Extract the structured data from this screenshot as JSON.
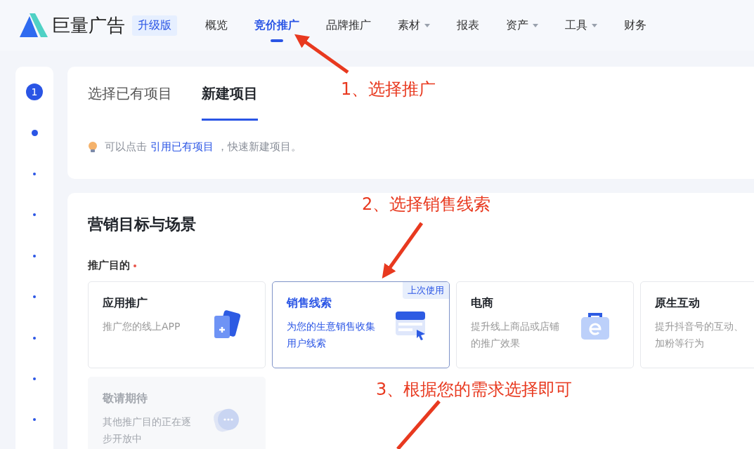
{
  "header": {
    "logo": "巨量广告",
    "edition_badge": "升级版",
    "nav": [
      {
        "label": "概览",
        "selected": false,
        "dropdown": false
      },
      {
        "label": "竞价推广",
        "selected": true,
        "dropdown": false
      },
      {
        "label": "品牌推广",
        "selected": false,
        "dropdown": false
      },
      {
        "label": "素材",
        "selected": false,
        "dropdown": true
      },
      {
        "label": "报表",
        "selected": false,
        "dropdown": false
      },
      {
        "label": "资产",
        "selected": false,
        "dropdown": true
      },
      {
        "label": "工具",
        "selected": false,
        "dropdown": true
      },
      {
        "label": "财务",
        "selected": false,
        "dropdown": false
      }
    ]
  },
  "steps": [
    {
      "kind": "number",
      "label": "1"
    },
    {
      "kind": "large-dot"
    },
    {
      "kind": "dot"
    },
    {
      "kind": "dot"
    },
    {
      "kind": "dot"
    },
    {
      "kind": "dot"
    },
    {
      "kind": "dot"
    },
    {
      "kind": "dot"
    },
    {
      "kind": "dot"
    }
  ],
  "project_panel": {
    "tabs": [
      {
        "label": "选择已有项目",
        "selected": false
      },
      {
        "label": "新建项目",
        "selected": true
      }
    ],
    "hint": {
      "prefix": "可以点击 ",
      "link": "引用已有项目",
      "suffix": " ，快速新建项目。"
    }
  },
  "goal_panel": {
    "title": "营销目标与场景",
    "field_label": "推广目的",
    "required": true,
    "options": [
      {
        "kind": "app",
        "title": "应用推广",
        "description": "推广您的线上APP",
        "selected": false,
        "disabled": false
      },
      {
        "kind": "leads",
        "title": "销售线索",
        "description": "为您的生意销售收集用户线索",
        "selected": true,
        "disabled": false,
        "badge": "上次使用"
      },
      {
        "kind": "ecommerce",
        "title": "电商",
        "description": "提升线上商品或店铺的推广效果",
        "selected": false,
        "disabled": false
      },
      {
        "kind": "interaction",
        "title": "原生互动",
        "description": "提升抖音号的互动、加粉等行为",
        "selected": false,
        "disabled": false
      },
      {
        "kind": "coming-soon",
        "title": "敬请期待",
        "description": "其他推广目的正在逐步开放中",
        "selected": false,
        "disabled": true
      }
    ]
  },
  "annotations": [
    {
      "text": "1、选择推广"
    },
    {
      "text": "2、选择销售线索"
    },
    {
      "text": "3、根据您的需求选择即可"
    }
  ]
}
